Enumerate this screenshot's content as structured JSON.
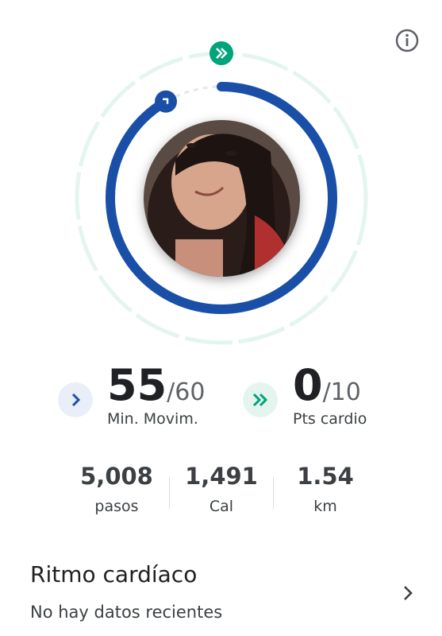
{
  "stats": {
    "move_minutes": {
      "value": "55",
      "goal": "/60",
      "label": "Min. Movim.",
      "progress": 0.9167,
      "color": "#1a4fa8"
    },
    "heart_points": {
      "value": "0",
      "goal": "/10",
      "label": "Pts cardio",
      "progress": 0,
      "color": "#00a37a"
    }
  },
  "metrics": [
    {
      "value": "5,008",
      "unit": "pasos"
    },
    {
      "value": "1,491",
      "unit": "Cal"
    },
    {
      "value": "1.54",
      "unit": "km"
    }
  ],
  "heart_rate": {
    "title": "Ritmo cardíaco",
    "subtitle": "No hay datos recientes"
  },
  "icons": {
    "info": "info-icon",
    "move": "chevron-right-icon",
    "heart": "double-chevron-right-icon",
    "nav": "chevron-right-icon"
  }
}
